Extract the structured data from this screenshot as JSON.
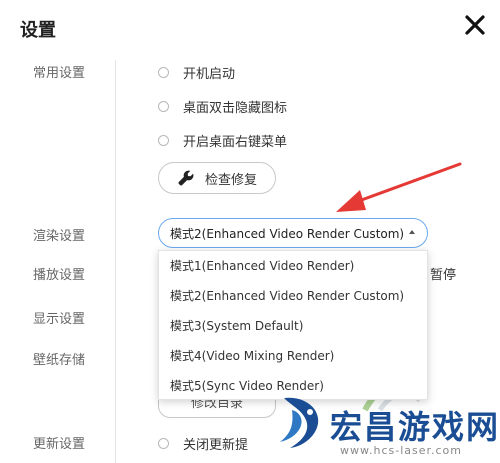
{
  "window": {
    "title": "设置"
  },
  "sections": {
    "general": "常用设置",
    "render": "渲染设置",
    "playback": "播放设置",
    "display": "显示设置",
    "wallpaper": "壁纸存储",
    "update": "更新设置"
  },
  "general": {
    "options": [
      "开机启动",
      "桌面双击隐藏图标",
      "开启桌面右键菜单"
    ],
    "repair_button": "检查修复"
  },
  "render": {
    "selected": "模式2(Enhanced Video Render Custom)",
    "options": [
      "模式1(Enhanced Video Render)",
      "模式2(Enhanced Video Render Custom)",
      "模式3(System Default)",
      "模式4(Video Mixing Render)",
      "模式5(Sync Video Render)"
    ]
  },
  "playback": {
    "pause_text": "暂停"
  },
  "wallpaper": {
    "dir_button": "修改目录"
  },
  "update": {
    "option": "关闭更新提"
  },
  "watermark": {
    "title": "宏昌游戏网",
    "url": "www.hcs-laser.com"
  },
  "colors": {
    "accent": "#6aa9ee",
    "arrow": "#e53935",
    "watermark": "#1a4d94"
  }
}
